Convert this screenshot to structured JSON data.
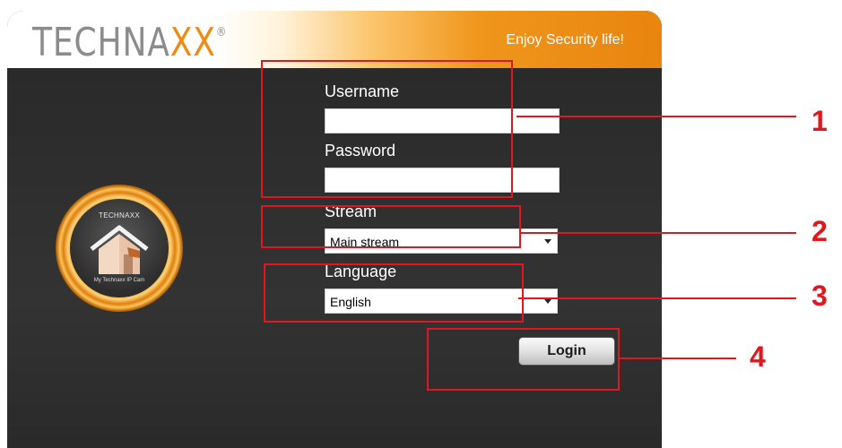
{
  "header": {
    "logo_main": "TECHNA",
    "logo_accent": "XX",
    "logo_reg": "®",
    "tagline": "Enjoy Security life!"
  },
  "badge": {
    "brand": "TECHNAXX",
    "caption": "My Technaxx IP Cam"
  },
  "form": {
    "username_label": "Username",
    "username_value": "",
    "password_label": "Password",
    "password_value": "",
    "stream_label": "Stream",
    "stream_selected": "Main stream",
    "language_label": "Language",
    "language_selected": "English",
    "login_label": "Login"
  },
  "annotations": [
    "1",
    "2",
    "3",
    "4"
  ],
  "colors": {
    "accent": "#f08a13",
    "annotation": "#e0181e",
    "panel": "#2b2b2b"
  }
}
